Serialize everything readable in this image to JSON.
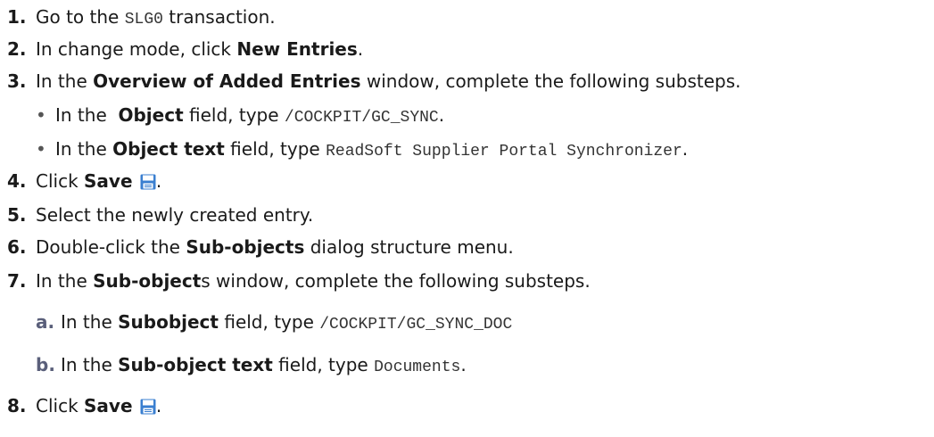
{
  "steps": [
    {
      "num": "1.",
      "a": "Go to the ",
      "code": "SLG0",
      "b": " transaction."
    },
    {
      "num": "2.",
      "a": "In change mode, click ",
      "bold": "New Entries",
      "b": "."
    },
    {
      "num": "3.",
      "a": "In the ",
      "bold": "Overview of Added Entries",
      "b": " window, complete the following substeps."
    },
    {
      "num": "4.",
      "a": "Click ",
      "bold": "Save",
      "b": "."
    },
    {
      "num": "5.",
      "a": "Select the newly created entry."
    },
    {
      "num": "6.",
      "a": "Double-click the ",
      "bold": "Sub-objects",
      "b": " dialog structure menu."
    },
    {
      "num": "7.",
      "a": "In the ",
      "bold": "Sub-object",
      "b": "s window, complete the following substeps."
    },
    {
      "num": "8.",
      "a": "Click ",
      "bold": "Save",
      "b": "."
    }
  ],
  "step3_substeps": [
    {
      "bullet": "•",
      "a": "In the  ",
      "bold": "Object",
      "b": " field, type ",
      "code": "/COCKPIT/GC_SYNC",
      "c": "."
    },
    {
      "bullet": "•",
      "a": "In the ",
      "bold": "Object text",
      "b": " field, type ",
      "code": "ReadSoft Supplier Portal Synchronizer",
      "c": "."
    }
  ],
  "step7_substeps": [
    {
      "mark": "a.",
      "a": "In the ",
      "bold": "Subobject",
      "b": " field, type ",
      "code": "/COCKPIT/GC_SYNC_DOC",
      "c": ""
    },
    {
      "mark": "b.",
      "a": "In the ",
      "bold": "Sub-object text",
      "b": " field, type ",
      "code": "Documents",
      "c": "."
    }
  ],
  "icons": {
    "save": "save-floppy-icon",
    "save_color": "#3a7fd0"
  }
}
